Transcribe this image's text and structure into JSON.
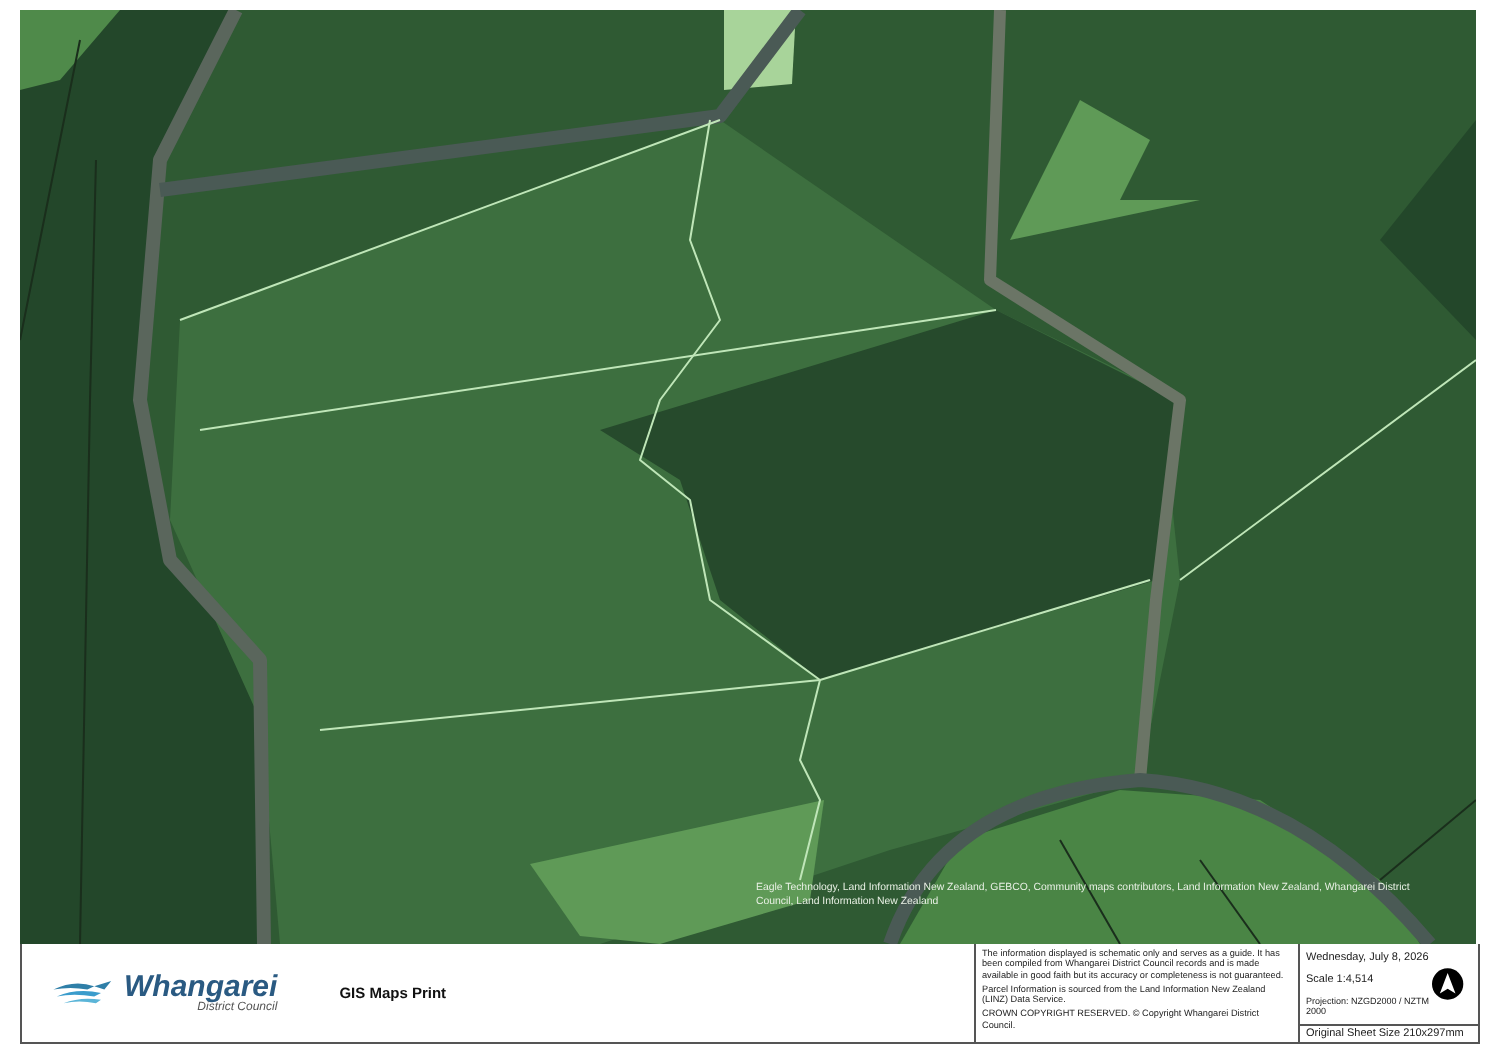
{
  "map": {
    "attribution": "Eagle Technology, Land Information New Zealand, GEBCO, Community maps contributors, Land Information New Zealand, Whangarei District Council, Land Information New Zealand"
  },
  "footer": {
    "logo": {
      "name": "Whangarei",
      "subtitle": "District Council"
    },
    "title": "GIS Maps Print",
    "disclaimer": [
      "The information displayed is schematic only and serves as a guide. It has been compiled from Whangarei District Council records and is made available in good faith but its accuracy or completeness is not guaranteed.",
      "Parcel Information is sourced from the Land Information New Zealand (LINZ) Data Service.",
      "CROWN COPYRIGHT RESERVED. © Copyright Whangarei District Council."
    ],
    "date": "Wednesday, July 8, 2026",
    "scale": "Scale 1:4,514",
    "projection": "Projection: NZGD2000 / NZTM 2000",
    "sheet_size": "Original Sheet Size 210x297mm"
  }
}
